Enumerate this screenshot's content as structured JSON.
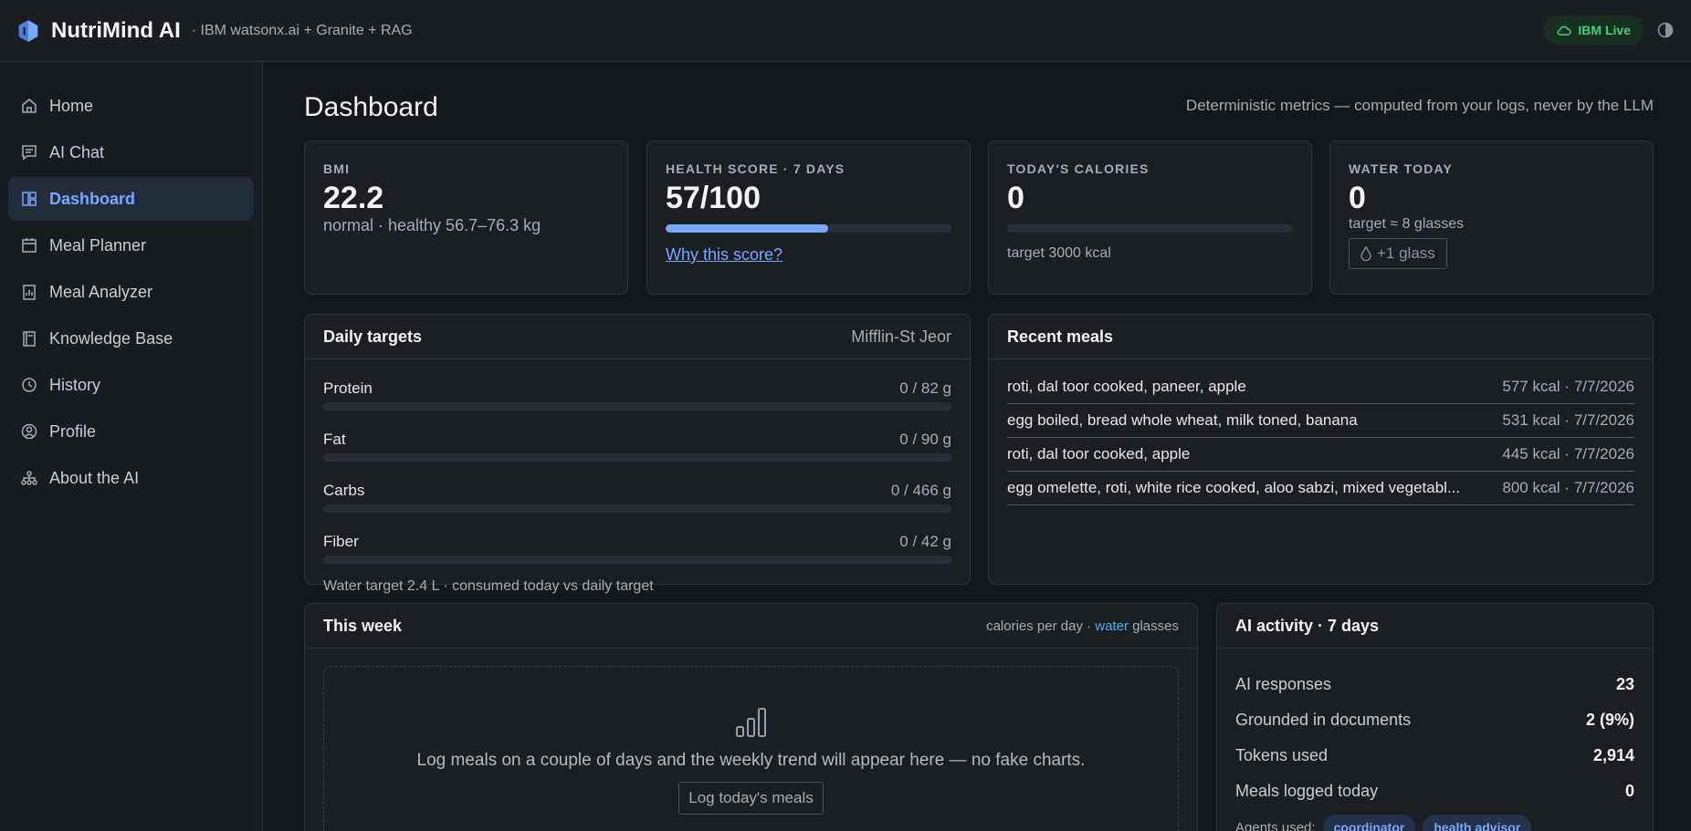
{
  "header": {
    "title": "NutriMind AI",
    "subtitle": "· IBM watsonx.ai + Granite + RAG",
    "status_badge": "IBM Live",
    "accent_color": "#78a9ff",
    "status_color": "#4ecb74"
  },
  "sidebar": {
    "items": [
      {
        "label": "Home",
        "icon": "home-icon"
      },
      {
        "label": "AI Chat",
        "icon": "chat-icon"
      },
      {
        "label": "Dashboard",
        "icon": "dashboard-icon",
        "active": true
      },
      {
        "label": "Meal Planner",
        "icon": "calendar-icon"
      },
      {
        "label": "Meal Analyzer",
        "icon": "analyzer-icon"
      },
      {
        "label": "Knowledge Base",
        "icon": "book-icon"
      },
      {
        "label": "History",
        "icon": "history-icon"
      },
      {
        "label": "Profile",
        "icon": "profile-icon"
      },
      {
        "label": "About the AI",
        "icon": "network-icon"
      }
    ]
  },
  "page": {
    "title": "Dashboard",
    "note": "Deterministic metrics — computed from your logs, never by the LLM"
  },
  "stats": {
    "bmi": {
      "label": "BMI",
      "value": "22.2",
      "sub": "normal · healthy 56.7–76.3 kg"
    },
    "health": {
      "label": "HEALTH SCORE · 7 DAYS",
      "value": "57/100",
      "progress": 0.57,
      "link": "Why this score?"
    },
    "calories": {
      "label": "TODAY'S CALORIES",
      "value": "0",
      "progress": 0,
      "sub": "target 3000 kcal"
    },
    "water": {
      "label": "WATER TODAY",
      "value": "0",
      "sub": "target ≈ 8 glasses",
      "button": "+1 glass"
    }
  },
  "daily_targets": {
    "title": "Daily targets",
    "method": "Mifflin-St Jeor",
    "rows": [
      {
        "name": "Protein",
        "value": "0 / 82 g",
        "progress": 0
      },
      {
        "name": "Fat",
        "value": "0 / 90 g",
        "progress": 0
      },
      {
        "name": "Carbs",
        "value": "0 / 466 g",
        "progress": 0
      },
      {
        "name": "Fiber",
        "value": "0 / 42 g",
        "progress": 0
      }
    ],
    "footer": "Water target 2.4 L · consumed today vs daily target"
  },
  "recent_meals": {
    "title": "Recent meals",
    "rows": [
      {
        "name": "roti, dal toor cooked, paneer, apple",
        "meta": "577 kcal · 7/7/2026"
      },
      {
        "name": "egg boiled, bread whole wheat, milk toned, banana",
        "meta": "531 kcal · 7/7/2026"
      },
      {
        "name": "roti, dal toor cooked, apple",
        "meta": "445 kcal · 7/7/2026"
      },
      {
        "name": "egg omelette, roti, white rice cooked, aloo sabzi, mixed vegetabl...",
        "meta": "800 kcal · 7/7/2026"
      }
    ]
  },
  "week": {
    "title": "This week",
    "legend_prefix": "calories per day · ",
    "legend_accent": "water",
    "legend_suffix": " glasses",
    "empty_text": "Log meals on a couple of days and the weekly trend will appear here — no fake charts.",
    "button": "Log today's meals"
  },
  "activity": {
    "title": "AI activity · 7 days",
    "rows": [
      {
        "label": "AI responses",
        "value": "23"
      },
      {
        "label": "Grounded in documents",
        "value": "2 (9%)"
      },
      {
        "label": "Tokens used",
        "value": "2,914"
      },
      {
        "label": "Meals logged today",
        "value": "0"
      }
    ],
    "agents_label": "Agents used:",
    "agents": [
      "coordinator",
      "health advisor"
    ]
  }
}
